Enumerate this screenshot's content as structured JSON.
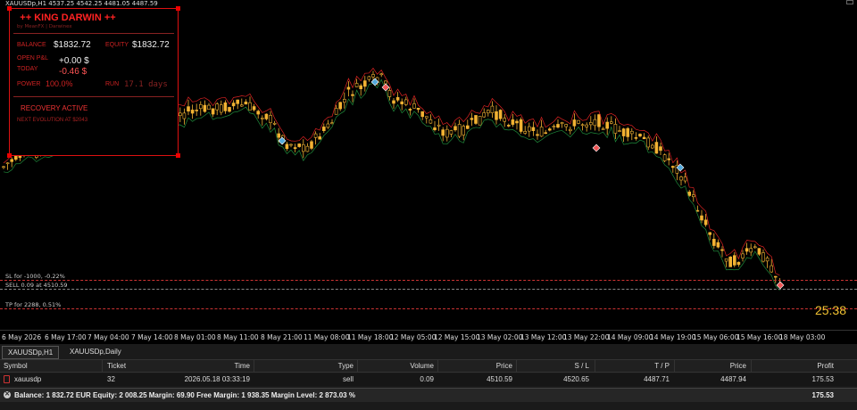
{
  "chart": {
    "title": "XAUUSDp,H1  4537.25 4542.25 4481.05 4487.59",
    "countdown": "25:38",
    "lines": {
      "sl_label": "SL for -1000, -0.22%",
      "sell_label": "SELL 0.09 at 4510.59",
      "tp_label": "TP for 2288, 0.51%"
    },
    "xaxis": [
      "6 May 2026",
      "6 May 17:00",
      "7 May 04:00",
      "7 May 14:00",
      "8 May 01:00",
      "8 May 11:00",
      "8 May 21:00",
      "11 May 08:00",
      "11 May 18:00",
      "12 May 05:00",
      "12 May 15:00",
      "13 May 02:00",
      "13 May 12:00",
      "13 May 22:00",
      "14 May 09:00",
      "14 May 19:00",
      "15 May 06:00",
      "15 May 16:00",
      "18 May 03:00"
    ],
    "colors": {
      "bull": "#f2b233",
      "bear": "#f2b233",
      "wick": "#f2b233",
      "envelope_red": "#d22",
      "envelope_green": "#1f8a3a",
      "sl_line": "#c33",
      "tp_line": "#c33",
      "sell_line": "#888"
    }
  },
  "panel": {
    "title": "++ KING DARWIN ++",
    "subtitle": "by MeanFX  |  Darwinex",
    "balance_label": "BALANCE",
    "balance": "$1832.72",
    "equity_label": "EQUITY",
    "equity": "$1832.72",
    "open_pnl_label": "OPEN P&L",
    "open_pnl": "+0.00 $",
    "today_label": "TODAY",
    "today": "-0.46 $",
    "power_label": "POWER",
    "power": "100.0%",
    "run_label": "RUN",
    "run": "17.1 days",
    "recovery": "RECOVERY ACTIVE",
    "next_evolution": "NEXT EVOLUTION AT $2043"
  },
  "tabs": [
    "XAUUSDp,H1",
    "XAUUSDp,Daily"
  ],
  "table": {
    "headers": [
      "Symbol",
      "Ticket",
      "Time",
      "Type",
      "Volume",
      "Price",
      "S / L",
      "T / P",
      "Price",
      "Profit"
    ],
    "rows": [
      {
        "symbol": "xauusdp",
        "ticket": "32",
        "time": "2026.05.18 03:33:19",
        "type": "sell",
        "volume": "0.09",
        "price": "4510.59",
        "sl": "4520.65",
        "tp": "4487.71",
        "cur_price": "4487.94",
        "profit": "175.53"
      }
    ],
    "summary": "Balance: 1 832.72 EUR  Equity: 2 008.25  Margin: 69.90  Free Margin: 1 938.35  Margin Level: 2 873.03 %",
    "summary_profit": "175.53"
  }
}
